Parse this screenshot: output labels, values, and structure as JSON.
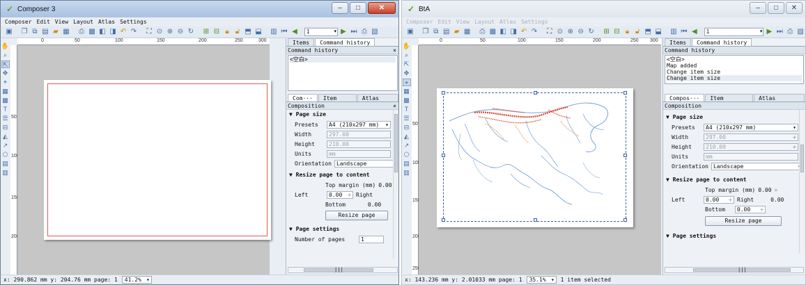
{
  "window1": {
    "title": "Composer 3",
    "menu": [
      "Composer",
      "Edit",
      "View",
      "Layout",
      "Atlas",
      "Settings"
    ],
    "nav_value": "1",
    "ruler_h": [
      "0",
      "50",
      "100",
      "150",
      "200",
      "250",
      "300"
    ],
    "ruler_v": [
      "50",
      "100",
      "150",
      "200"
    ],
    "tabs": [
      "Items",
      "Command history"
    ],
    "history_header": "Command history",
    "history_items": [
      "<空白>"
    ],
    "subtabs": [
      "Com···",
      "Item pr···",
      "Atlas ge···"
    ],
    "composition_header": "Composition",
    "page_size_label": "▼ Page size",
    "presets_label": "Presets",
    "presets_value": "A4 (210x297 mm)",
    "width_label": "Width",
    "width_value": "297.00",
    "height_label": "Height",
    "height_value": "210.00",
    "units_label": "Units",
    "units_value": "mm",
    "orientation_label": "Orientation",
    "orientation_value": "Landscape",
    "resize_label": "▼ Resize page to content",
    "top_margin_label": "Top margin (mm)",
    "top_margin_value": "0.00",
    "left_label": "Left",
    "left_value": "0.00",
    "right_label": "Right",
    "bottom_label": "Bottom",
    "bottom_value": "0.00",
    "resize_button": "Resize page",
    "page_settings_label": "▼ Page settings",
    "num_pages_label": "Number of pages",
    "num_pages_value": "1",
    "scroll_mark": "|||",
    "status": "x: 290.862 mm y: 204.76 mm page: 1",
    "zoom": "41.2%"
  },
  "window2": {
    "title": "BtA",
    "menu": [
      "Composer",
      "Edit",
      "View",
      "Layout",
      "Atlas",
      "Settings"
    ],
    "nav_value": "1",
    "ruler_h": [
      "0",
      "50",
      "100",
      "150",
      "200",
      "250",
      "300"
    ],
    "ruler_v": [
      "50",
      "100",
      "150",
      "200",
      "250"
    ],
    "tabs": [
      "Items",
      "Command history"
    ],
    "history_header": "Command history",
    "history_items": [
      "<空白>",
      "Map added",
      "Change item size",
      "Change item size"
    ],
    "subtabs": [
      "Compos···",
      "Item prope···",
      "Atlas gener···"
    ],
    "composition_header": "Composition",
    "page_size_label": "▼ Page size",
    "presets_label": "Presets",
    "presets_value": "A4 (210x297 mm)",
    "width_label": "Width",
    "width_value": "297.00",
    "height_label": "Height",
    "height_value": "210.00",
    "units_label": "Units",
    "units_value": "mm",
    "orientation_label": "Orientation",
    "orientation_value": "Landscape",
    "resize_label": "▼ Resize page to content",
    "top_margin_label": "Top margin (mm)",
    "top_margin_value": "0.00",
    "left_label": "Left",
    "left_value": "0.00",
    "right_label": "Right",
    "right_value": "0.00",
    "bottom_label": "Bottom",
    "bottom_value": "0.00",
    "resize_button": "Resize page",
    "page_settings_label": "▼ Page settings",
    "scroll_mark": "|||",
    "status": "x: 143.236 mm y: 2.01033 mm page: 1",
    "zoom": "35.1%",
    "selection": "1 item selected"
  },
  "colors": {
    "accent": "#3b5ea6",
    "map_red": "#d9452b",
    "map_blue": "#5b8fc9",
    "margin_red": "#e05a5a"
  }
}
